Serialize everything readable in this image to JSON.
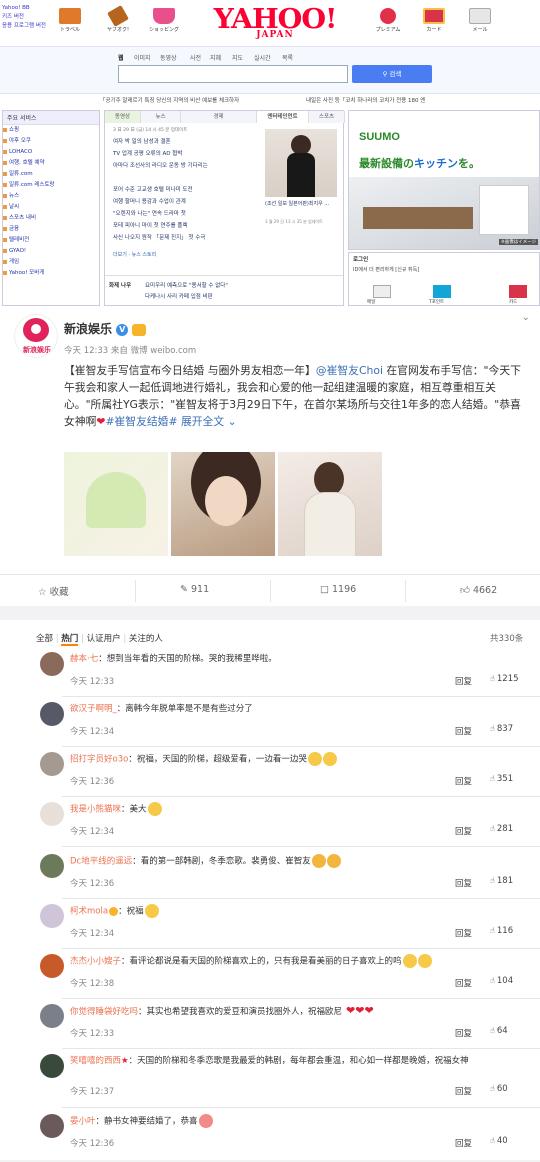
{
  "yahoo": {
    "top_links": [
      "Yahoo! BB",
      "키즈 버전",
      "응용 프로그램 버전"
    ],
    "logo_main": "YAHOO!",
    "logo_sub": "JAPAN",
    "icons": [
      {
        "label": "トラベル",
        "icon": "briefcase-icon",
        "color": "#e07a2a"
      },
      {
        "label": "ヤフオク!",
        "icon": "gavel-icon",
        "color": "#b5651d"
      },
      {
        "label": "ショッピング",
        "icon": "cart-icon",
        "color": "#e94f8a"
      },
      {
        "label": "プレミアム",
        "icon": "ribbon-icon",
        "color": "#e2304b"
      },
      {
        "label": "カード",
        "icon": "card-icon",
        "color": "#d9334a"
      },
      {
        "label": "メール",
        "icon": "mail-icon",
        "color": "#b8b8b8"
      }
    ],
    "search_tabs": [
      "웹",
      "이미지",
      "동영상",
      "사전",
      "지혜",
      "지도",
      "실시간",
      "목록"
    ],
    "search_button": "검색",
    "notice_left": "「공기주 알레르기 특징 당신의 지역의 비산 예보를 체크하자",
    "notice_right": "내일은 사진 등「코치 하나라의 코치가 전용 180 엔",
    "nav_header": "주요 서비스",
    "nav_items": [
      "쇼핑",
      "야후 오쿠",
      "LOHACO",
      "여행, 호텔 예약",
      "일류.com",
      "일류.com 레스토랑",
      "뉴스",
      "날씨",
      "스포츠 내비",
      "금융",
      "텔레비전",
      "GYAO!",
      "게임",
      "Yahoo! 모바게"
    ],
    "news_tabs": [
      "동영상",
      "뉴스",
      "경제",
      "엔터테인먼트",
      "스포츠"
    ],
    "news_date": "3 日 29 日 (금) 14 시 45 분 업데이트",
    "news_items": [
      "여자 박 일의 남성과 결혼",
      "TV 업계 공평 오류의 AD 협박",
      "아마다 조선사의 라디오 운동 방 기다리는",
      "포어 수준 고교생 호텔 미나미 도전",
      "여행 할머니 용감과 수업이 관계",
      "\"오렌지와 나는\" 연속 드라마 첫",
      "포테 피아니 마이 첫 연주를 플렉",
      "사신 나오지 원작 「문제 진지」 첫 수극"
    ],
    "news_more": "더보기",
    "news_more2": "뉴스 스토리",
    "news_photo_caption": "(조선 일보 일본어판)최지우 ...",
    "news_photo_time": "3 월 29 日 13 시 35 분 업데이트",
    "sub_label": "화제 나우",
    "sub_text1": "요미우리 예측으로 \"용서할 수 없다\"",
    "sub_text2": "다케나시 사리 카페 입점 비판",
    "ad_brand": "SUUMO",
    "ad_headline_1": "最新設備の",
    "ad_headline_2": "キッチン",
    "ad_headline_3": "を。",
    "ad_caption": "※画像はイメージ",
    "login_label": "로그인",
    "login_text": "ID에서 더 편리하게 [신규 취득]",
    "login_links": [
      "메일",
      "T포인트",
      "카드"
    ]
  },
  "post": {
    "account_name": "新浪娱乐",
    "avatar_text": "新浪娱乐",
    "meta": "今天 12:33 来自 微博 weibo.com",
    "text_headline": "【崔智友手写信宣布今日结婚 与圈外男友相恋一年】",
    "mention": "@崔智友Choi",
    "text_body": " 在官网发布手写信：\"今天下午我会和家人一起低调地进行婚礼，我会和心爱的他一起组建温暖的家庭，相互尊重相互关心。\"所属社YG表示：\"崔智友将于3月29日下午，在首尔某场所与交往1年多的恋人结婚。\"恭喜女神啊",
    "hashtag": "#崔智友结婚#",
    "expand": "展开全文",
    "actions": {
      "favorite": "收藏",
      "repost": "911",
      "comment": "1196",
      "like": "4662"
    }
  },
  "comments_section": {
    "filters": [
      "全部",
      "热门",
      "认证用户",
      "关注的人"
    ],
    "total": "共330条",
    "reply_label": "回复",
    "comments": [
      {
        "user": "赫本·七",
        "text": "：想到当年看的天国的阶梯。哭的我稀里哗啦。",
        "time": "今天 12:33",
        "likes": "1215",
        "avatar_color": "#8a6a5a"
      },
      {
        "user": "欲汉子啊明_",
        "text": "：离韩今年脱单率是不是有些过分了",
        "time": "今天 12:34",
        "likes": "837",
        "avatar_color": "#555a66"
      },
      {
        "user": "招打字员好o3o",
        "text": "：祝福，天国的阶梯，超级爱看，一边看一边哭",
        "time": "今天 12:36",
        "likes": "351",
        "avatar_color": "#a59a90"
      },
      {
        "user": "我是小熊猫咪",
        "text": "：美大",
        "time": "今天 12:34",
        "likes": "281",
        "avatar_color": "#e8e0d8"
      },
      {
        "user": "Dc地平线的遥远",
        "text": "：看的第一部韩剧，冬季恋歌。裴勇俊、崔智友",
        "time": "今天 12:36",
        "likes": "181",
        "avatar_color": "#6b7a5a"
      },
      {
        "user": "柯术mola",
        "text": "：祝福",
        "time": "今天 12:34",
        "likes": "116",
        "avatar_color": "#cfc4d8"
      },
      {
        "user": "杰杰小小嫂子",
        "text": "：看评论都说是看天国的阶梯喜欢上的，只有我是看美丽的日子喜欢上的呜",
        "time": "今天 12:38",
        "likes": "104",
        "avatar_color": "#c85a2a"
      },
      {
        "user": "你觉得睡袋好吃吗",
        "text": "：其实也希望我喜欢的爱豆和演员找圈外人，祝福欧尼",
        "time": "今天 12:33",
        "likes": "64",
        "avatar_color": "#7a7f8a"
      },
      {
        "user": "笑嘻嘻的西西",
        "text": "：天国的阶梯和冬季恋歌是我最爱的韩剧，每年都会重温，和心如一样都是晚婚，祝福女神",
        "time": "今天 12:37",
        "likes": "60",
        "avatar_color": "#3a4a3a"
      },
      {
        "user": "晏小叶",
        "text": "：静书女神要结婚了，恭喜",
        "time": "今天 12:36",
        "likes": "40",
        "avatar_color": "#6a5a5a"
      }
    ]
  },
  "colors": {
    "orange_name": "#eb7350",
    "link_blue": "#3b6fb6",
    "yahoo_red": "#ff0033",
    "search_blue": "#4a7df2"
  }
}
